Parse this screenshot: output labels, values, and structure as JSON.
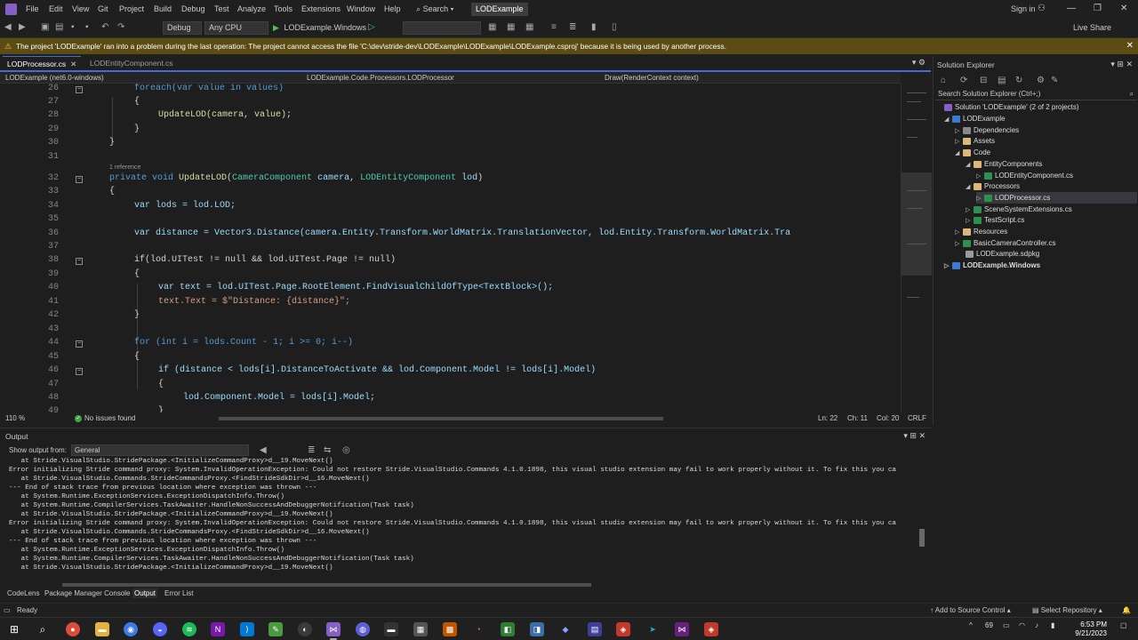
{
  "menubar": {
    "items": [
      "File",
      "Edit",
      "View",
      "Git",
      "Project",
      "Build",
      "Debug",
      "Test",
      "Analyze",
      "Tools",
      "Extensions",
      "Window",
      "Help"
    ],
    "search_label": "Search",
    "solution_name": "LODExample",
    "signin_label": "Sign in"
  },
  "toolbar": {
    "config": "Debug",
    "platform": "Any CPU",
    "run_target": "LODExample.Windows",
    "live_share": "Live Share"
  },
  "warning": {
    "text": "The project 'LODExample' ran into a problem during the last operation: The project cannot access the file 'C:\\dev\\stride-dev\\LODExample\\LODExample\\LODExample.csproj' because it is being used by another process."
  },
  "editor": {
    "tabs": [
      {
        "label": "LODProcessor.cs"
      },
      {
        "label": "LODEntityComponent.cs"
      }
    ],
    "nav": {
      "project": "LODExample (net6.0-windows)",
      "class": "LODExample.Code.Processors.LODProcessor",
      "member": "Draw(RenderContext context)"
    },
    "codelens": "1 reference",
    "line_numbers": [
      "26",
      "27",
      "28",
      "29",
      "30",
      "31",
      "32",
      "33",
      "34",
      "35",
      "36",
      "37",
      "38",
      "39",
      "40",
      "41",
      "42",
      "43",
      "44",
      "45",
      "46",
      "47",
      "48",
      "49"
    ],
    "lines": [
      "foreach(var value in values)",
      "{",
      "UpdateLOD(camera, value);",
      "}",
      "}",
      "",
      "private void UpdateLOD(CameraComponent camera, LODEntityComponent lod)",
      "{",
      "var lods = lod.LOD;",
      "",
      "var distance = Vector3.Distance(camera.Entity.Transform.WorldMatrix.TranslationVector, lod.Entity.Transform.WorldMatrix.Tra",
      "",
      "if(lod.UITest != null && lod.UITest.Page != null)",
      "{",
      "var text = lod.UITest.Page.RootElement.FindVisualChildOfType<TextBlock>();",
      "text.Text = $\"Distance: {distance}\";",
      "}",
      "",
      "for (int i = lods.Count - 1; i >= 0; i--)",
      "{",
      "if (distance < lods[i].DistanceToActivate && lod.Component.Model != lods[i].Model)",
      "{",
      "lod.Component.Model = lods[i].Model;",
      "}"
    ],
    "status": {
      "zoom": "110 %",
      "issues": "No issues found",
      "line": "Ln: 22",
      "ch": "Ch: 11",
      "col": "Col: 20",
      "eol": "CRLF"
    }
  },
  "solution_explorer": {
    "title": "Solution Explorer",
    "search_placeholder": "Search Solution Explorer (Ctrl+;)",
    "tree": [
      {
        "label": "Solution 'LODExample' (2 of 2 projects)"
      },
      {
        "label": "LODExample"
      },
      {
        "label": "Dependencies"
      },
      {
        "label": "Assets"
      },
      {
        "label": "Code"
      },
      {
        "label": "EntityComponents"
      },
      {
        "label": "LODEntityComponent.cs"
      },
      {
        "label": "Processors"
      },
      {
        "label": "LODProcessor.cs"
      },
      {
        "label": "SceneSystemExtensions.cs"
      },
      {
        "label": "TestScript.cs"
      },
      {
        "label": "Resources"
      },
      {
        "label": "BasicCameraController.cs"
      },
      {
        "label": "LODExample.sdpkg"
      },
      {
        "label": "LODExample.Windows"
      }
    ]
  },
  "output": {
    "title": "Output",
    "source_label": "Show output from:",
    "source_value": "General",
    "lines": [
      "   at Stride.VisualStudio.StridePackage.<InitializeCommandProxy>d__19.MoveNext()",
      "Error initializing Stride command proxy: System.InvalidOperationException: Could not restore Stride.VisualStudio.Commands 4.1.0.1898, this visual studio extension may fail to work properly without it. To fix this you ca",
      "   at Stride.VisualStudio.Commands.StrideCommandsProxy.<FindStrideSdkDir>d__16.MoveNext()",
      "--- End of stack trace from previous location where exception was thrown ---",
      "   at System.Runtime.ExceptionServices.ExceptionDispatchInfo.Throw()",
      "   at System.Runtime.CompilerServices.TaskAwaiter.HandleNonSuccessAndDebuggerNotification(Task task)",
      "   at Stride.VisualStudio.StridePackage.<InitializeCommandProxy>d__19.MoveNext()",
      "Error initializing Stride command proxy: System.InvalidOperationException: Could not restore Stride.VisualStudio.Commands 4.1.0.1898, this visual studio extension may fail to work properly without it. To fix this you ca",
      "   at Stride.VisualStudio.Commands.StrideCommandsProxy.<FindStrideSdkDir>d__16.MoveNext()",
      "--- End of stack trace from previous location where exception was thrown ---",
      "   at System.Runtime.ExceptionServices.ExceptionDispatchInfo.Throw()",
      "   at System.Runtime.CompilerServices.TaskAwaiter.HandleNonSuccessAndDebuggerNotification(Task task)",
      "   at Stride.VisualStudio.StridePackage.<InitializeCommandProxy>d__19.MoveNext()"
    ]
  },
  "bottom_tabs": [
    "CodeLens",
    "Package Manager Console",
    "Output",
    "Error List"
  ],
  "statusbar": {
    "ready": "Ready",
    "add_source_control": "Add to Source Control",
    "select_repository": "Select Repository"
  },
  "taskbar": {
    "time": "6:53 PM",
    "date": "9/21/2023",
    "tray_number": "69"
  }
}
